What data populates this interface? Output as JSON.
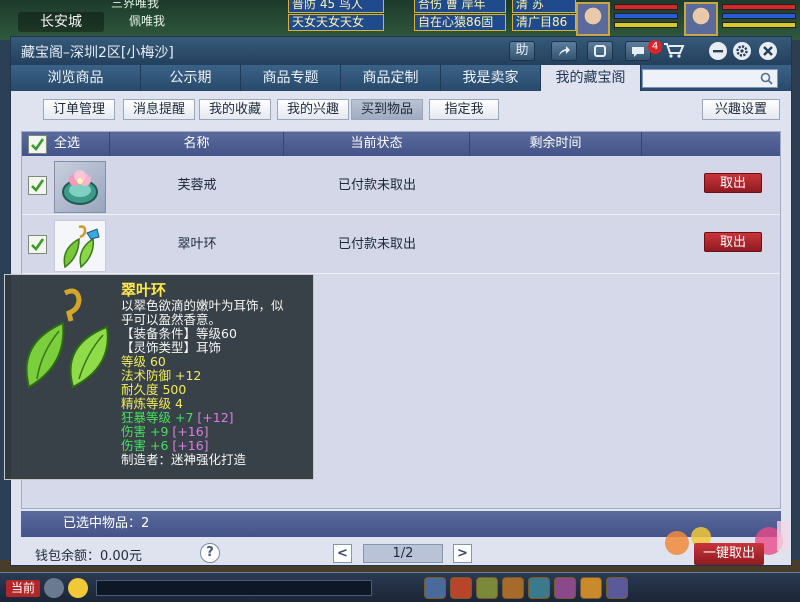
{
  "game": {
    "city": "长安城",
    "top_tags": [
      "三界唯我",
      "普防 45 鸟人",
      "合伤 曹 岸年",
      "清 苏",
      "天女天女天女",
      "自在心猿86固",
      "清广目86"
    ],
    "top_tags_row2": [
      "佩唯我"
    ],
    "bottom": {
      "current_channel": "当前"
    }
  },
  "window": {
    "title": "藏宝阁–深圳2区[小梅沙]",
    "title_buttons": {
      "help": "助",
      "badge": "4"
    },
    "tabs": [
      "浏览商品",
      "公示期",
      "商品专题",
      "商品定制",
      "我是卖家",
      "我的藏宝阁"
    ],
    "active_tab": 5,
    "search": {
      "placeholder": ""
    },
    "subtabs": [
      "订单管理",
      "消息提醒",
      "我的收藏",
      "我的兴趣",
      "买到物品",
      "指定我"
    ],
    "active_subtab": 4,
    "interest_button": "兴趣设置"
  },
  "table": {
    "headers": {
      "select_all": "全选",
      "name": "名称",
      "status": "当前状态",
      "remaining": "剩余时间"
    },
    "rows": [
      {
        "name": "芙蓉戒",
        "status": "已付款未取出",
        "remaining": "",
        "action": "取出"
      },
      {
        "name": "翠叶环",
        "status": "已付款未取出",
        "remaining": "",
        "action": "取出"
      }
    ]
  },
  "footer": {
    "selected": "已选中物品：2",
    "wallet": "钱包余额：0.00元",
    "help": "?",
    "page": "1/2",
    "prev": "<",
    "next": ">",
    "take_all": "一键取出"
  },
  "tooltip": {
    "name": "翠叶环",
    "desc1": "以翠色欲滴的嫩叶为耳饰，似",
    "desc2": "乎可以盈然香意。",
    "equip_cond": "【装备条件】等级60",
    "type": "【灵饰类型】耳饰",
    "level": "等级 60",
    "stat1": "法术防御 +12",
    "durability": "耐久度 500",
    "refine": "精炼等级 4",
    "stat2": "狂暴等级 +7",
    "stat2_bonus": "[+12]",
    "stat3": "伤害 +9",
    "stat3_bonus": "[+16]",
    "stat4": "伤害 +6",
    "stat4_bonus": "[+16]",
    "maker": "制造者：迷神强化打造"
  },
  "colors": {
    "title_bar": "#23405c",
    "tab_bar": "#284a6a",
    "table_header": "#4c5c90",
    "take_button": "#b02a30",
    "tooltip_name": "#ffe84a"
  }
}
